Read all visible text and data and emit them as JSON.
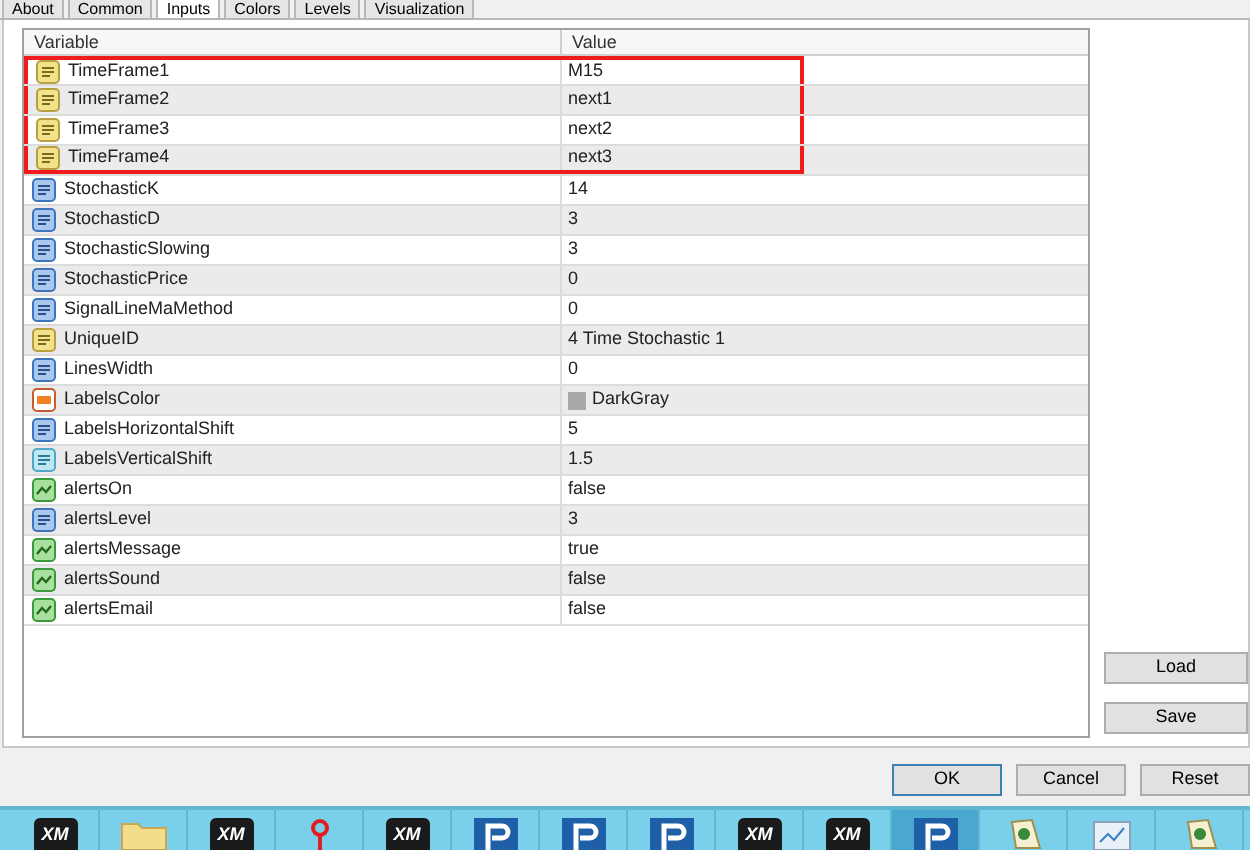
{
  "tabs": [
    {
      "label": "About",
      "selected": false
    },
    {
      "label": "Common",
      "selected": false
    },
    {
      "label": "Inputs",
      "selected": true
    },
    {
      "label": "Colors",
      "selected": false
    },
    {
      "label": "Levels",
      "selected": false
    },
    {
      "label": "Visualization",
      "selected": false
    }
  ],
  "table": {
    "columns": [
      "Variable",
      "Value"
    ],
    "rows": [
      {
        "kind": "string",
        "variable": "TimeFrame1",
        "value": "M15",
        "highlighted": true
      },
      {
        "kind": "string",
        "variable": "TimeFrame2",
        "value": "next1",
        "highlighted": true
      },
      {
        "kind": "string",
        "variable": "TimeFrame3",
        "value": "next2",
        "highlighted": true
      },
      {
        "kind": "string",
        "variable": "TimeFrame4",
        "value": "next3",
        "highlighted": true
      },
      {
        "kind": "int",
        "variable": "StochasticK",
        "value": "14",
        "highlighted": false
      },
      {
        "kind": "int",
        "variable": "StochasticD",
        "value": "3",
        "highlighted": false
      },
      {
        "kind": "int",
        "variable": "StochasticSlowing",
        "value": "3",
        "highlighted": false
      },
      {
        "kind": "int",
        "variable": "StochasticPrice",
        "value": "0",
        "highlighted": false
      },
      {
        "kind": "int",
        "variable": "SignalLineMaMethod",
        "value": "0",
        "highlighted": false
      },
      {
        "kind": "string",
        "variable": "UniqueID",
        "value": "4 Time Stochastic 1",
        "highlighted": false
      },
      {
        "kind": "int",
        "variable": "LinesWidth",
        "value": "0",
        "highlighted": false
      },
      {
        "kind": "color",
        "variable": "LabelsColor",
        "value": "DarkGray",
        "color": "#a9a9a9",
        "highlighted": false
      },
      {
        "kind": "int",
        "variable": "LabelsHorizontalShift",
        "value": "5",
        "highlighted": false
      },
      {
        "kind": "double",
        "variable": "LabelsVerticalShift",
        "value": "1.5",
        "highlighted": false
      },
      {
        "kind": "bool",
        "variable": "alertsOn",
        "value": "false",
        "highlighted": false
      },
      {
        "kind": "int",
        "variable": "alertsLevel",
        "value": "3",
        "highlighted": false
      },
      {
        "kind": "bool",
        "variable": "alertsMessage",
        "value": "true",
        "highlighted": false
      },
      {
        "kind": "bool",
        "variable": "alertsSound",
        "value": "false",
        "highlighted": false
      },
      {
        "kind": "bool",
        "variable": "alertsEmail",
        "value": "false",
        "highlighted": false
      }
    ]
  },
  "side_buttons": [
    "Load",
    "Save"
  ],
  "dialog_buttons": [
    {
      "label": "OK",
      "default": true
    },
    {
      "label": "Cancel",
      "default": false
    },
    {
      "label": "Reset",
      "default": false
    }
  ],
  "taskbar": [
    {
      "kind": "xm",
      "label": "XM",
      "selected": false
    },
    {
      "kind": "folder",
      "selected": false
    },
    {
      "kind": "xm",
      "label": "XM",
      "selected": false
    },
    {
      "kind": "pin",
      "selected": false
    },
    {
      "kind": "xm",
      "label": "XM",
      "selected": false
    },
    {
      "kind": "r",
      "selected": false
    },
    {
      "kind": "r",
      "selected": false
    },
    {
      "kind": "r",
      "selected": false
    },
    {
      "kind": "xm",
      "label": "XM",
      "selected": false
    },
    {
      "kind": "xm",
      "label": "XM",
      "selected": false
    },
    {
      "kind": "r",
      "selected": true
    },
    {
      "kind": "doc",
      "selected": false
    },
    {
      "kind": "window",
      "selected": false
    },
    {
      "kind": "doc",
      "selected": false
    }
  ]
}
